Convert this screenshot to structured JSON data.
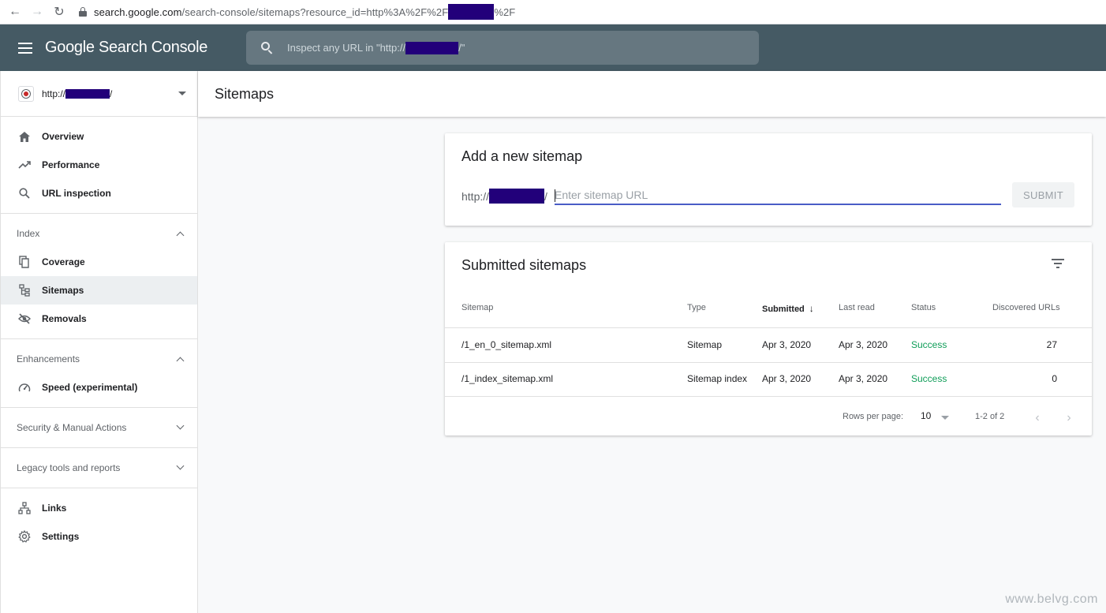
{
  "browser": {
    "url_domain": "search.google.com",
    "url_path": "/search-console/sitemaps?resource_id=http%3A%2F%2F",
    "url_suffix": "%2F"
  },
  "header": {
    "logo": "Google Search Console",
    "search_placeholder_prefix": "Inspect any URL in \"http://",
    "search_placeholder_suffix": "/\""
  },
  "property": {
    "prefix": "http://",
    "suffix": "/"
  },
  "sidebar": {
    "main": [
      {
        "label": "Overview",
        "icon": "home-icon"
      },
      {
        "label": "Performance",
        "icon": "trending-up-icon"
      },
      {
        "label": "URL inspection",
        "icon": "search-icon"
      }
    ],
    "index_title": "Index",
    "index_items": [
      {
        "label": "Coverage",
        "icon": "coverage-icon"
      },
      {
        "label": "Sitemaps",
        "icon": "sitemap-icon"
      },
      {
        "label": "Removals",
        "icon": "eye-off-icon"
      }
    ],
    "enhancements_title": "Enhancements",
    "enhancements_items": [
      {
        "label": "Speed (experimental)",
        "icon": "speedometer-icon"
      }
    ],
    "security_title": "Security & Manual Actions",
    "legacy_title": "Legacy tools and reports",
    "bottom": [
      {
        "label": "Links",
        "icon": "links-icon"
      },
      {
        "label": "Settings",
        "icon": "gear-icon"
      }
    ]
  },
  "page": {
    "title": "Sitemaps"
  },
  "add_sitemap": {
    "title": "Add a new sitemap",
    "prefix": "http://",
    "suffix": "/",
    "placeholder": "Enter sitemap URL",
    "submit_label": "SUBMIT"
  },
  "submitted": {
    "title": "Submitted sitemaps",
    "columns": {
      "sitemap": "Sitemap",
      "type": "Type",
      "submitted": "Submitted",
      "last_read": "Last read",
      "status": "Status",
      "discovered": "Discovered URLs"
    },
    "rows": [
      {
        "sitemap": "/1_en_0_sitemap.xml",
        "type": "Sitemap",
        "submitted": "Apr 3, 2020",
        "last_read": "Apr 3, 2020",
        "status": "Success",
        "discovered": "27"
      },
      {
        "sitemap": "/1_index_sitemap.xml",
        "type": "Sitemap index",
        "submitted": "Apr 3, 2020",
        "last_read": "Apr 3, 2020",
        "status": "Success",
        "discovered": "0"
      }
    ],
    "rows_per_page_label": "Rows per page:",
    "rows_per_page": "10",
    "range": "1-2 of 2"
  },
  "watermark": "www.belvg.com",
  "colors": {
    "header_bg": "#455a64",
    "accent": "#4a5cc6",
    "success": "#0f9d58"
  }
}
